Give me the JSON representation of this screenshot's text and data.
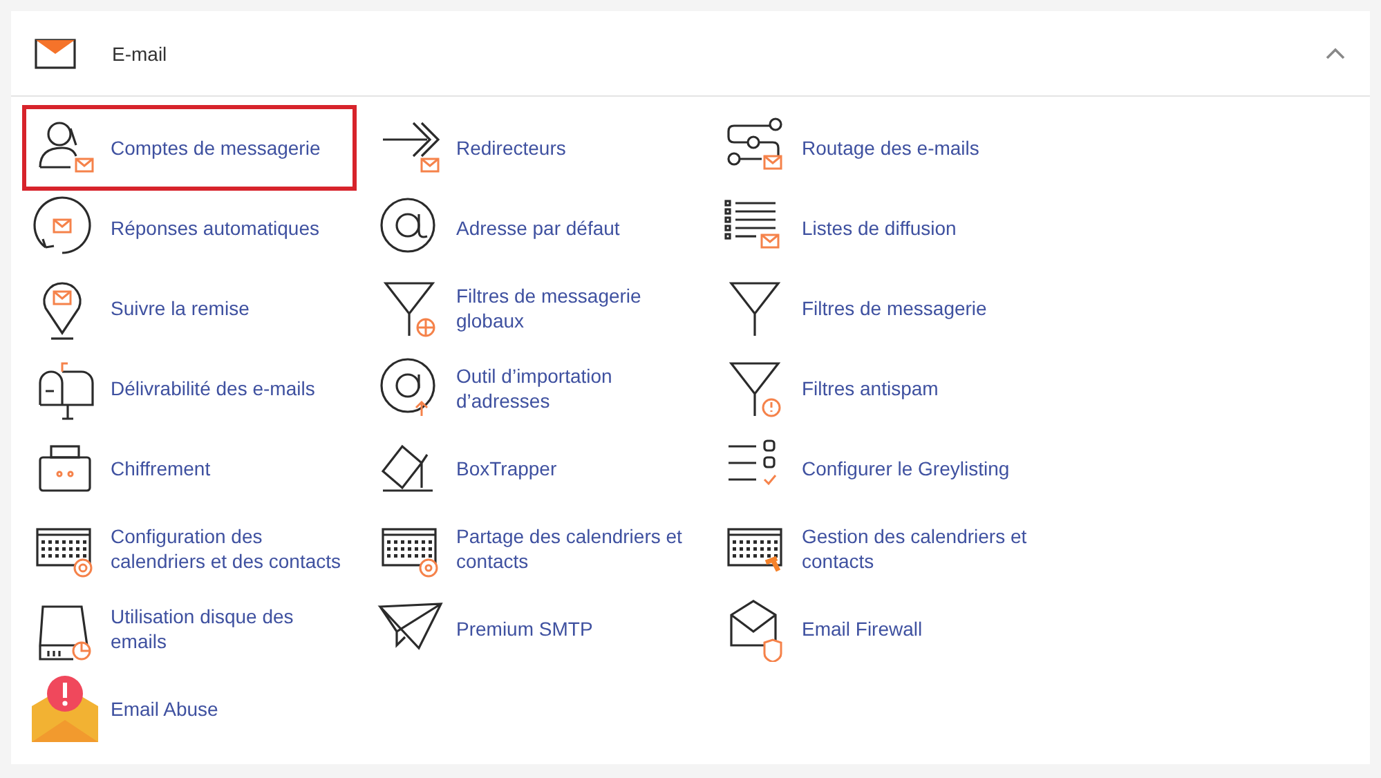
{
  "section": {
    "title": "E-mail",
    "expanded": true,
    "items": [
      {
        "label": "Comptes de messagerie",
        "highlighted": true
      },
      {
        "label": "Redirecteurs",
        "highlighted": false
      },
      {
        "label": "Routage des e-mails",
        "highlighted": false
      },
      {
        "label": "Réponses automatiques",
        "highlighted": false
      },
      {
        "label": "Adresse par défaut",
        "highlighted": false
      },
      {
        "label": "Listes de diffusion",
        "highlighted": false
      },
      {
        "label": "Suivre la remise",
        "highlighted": false
      },
      {
        "label": "Filtres de messagerie globaux",
        "highlighted": false
      },
      {
        "label": "Filtres de messagerie",
        "highlighted": false
      },
      {
        "label": "Délivrabilité des e-mails",
        "highlighted": false
      },
      {
        "label": "Outil d’importation d’adresses",
        "highlighted": false
      },
      {
        "label": "Filtres antispam",
        "highlighted": false
      },
      {
        "label": "Chiffrement",
        "highlighted": false
      },
      {
        "label": "BoxTrapper",
        "highlighted": false
      },
      {
        "label": "Configurer le Greylisting",
        "highlighted": false
      },
      {
        "label": "Configuration des calendriers et des contacts",
        "highlighted": false
      },
      {
        "label": "Partage des calendriers et contacts",
        "highlighted": false
      },
      {
        "label": "Gestion des calendriers et contacts",
        "highlighted": false
      },
      {
        "label": "Utilisation disque des emails",
        "highlighted": false
      },
      {
        "label": "Premium SMTP",
        "highlighted": false
      },
      {
        "label": "Email Firewall",
        "highlighted": false
      },
      {
        "label": "Email Abuse",
        "highlighted": false
      }
    ]
  }
}
